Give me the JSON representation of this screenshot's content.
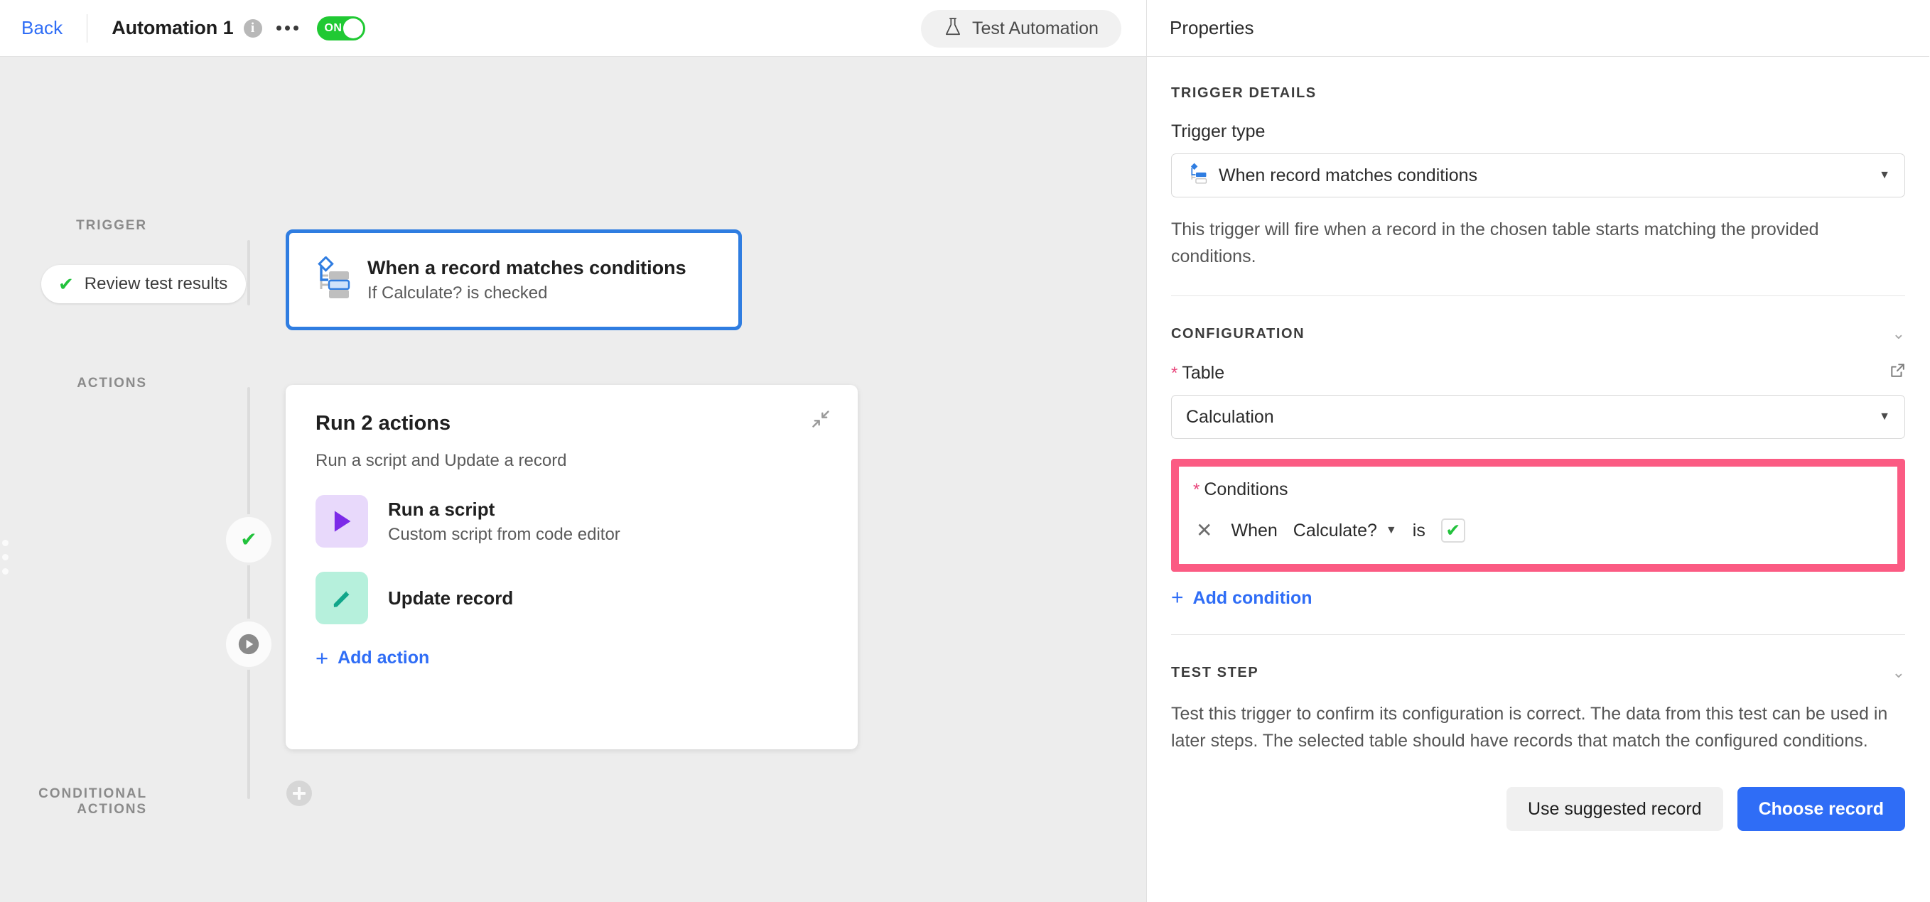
{
  "topbar": {
    "back_label": "Back",
    "automation_title": "Automation 1",
    "info_icon": "info-icon",
    "more_icon": "ellipsis-icon",
    "toggle_state_label": "ON",
    "toggle_on_color": "#20c933",
    "test_automation_label": "Test Automation",
    "test_automation_icon": "flask-icon"
  },
  "canvas": {
    "rail_labels": {
      "trigger": "TRIGGER",
      "actions": "ACTIONS",
      "conditional_actions": "CONDITIONAL ACTIONS"
    },
    "review_pill": {
      "label": "Review test results",
      "icon": "check-icon",
      "icon_color": "#22c23c"
    },
    "trigger_card": {
      "title": "When a record matches conditions",
      "subtitle": "If Calculate? is checked",
      "icon": "branch-conditions-icon",
      "border_color": "#2f7de1"
    },
    "actions_card": {
      "title": "Run 2 actions",
      "subtitle": "Run a script and Update a record",
      "collapse_icon": "collapse-diagonal-icon",
      "add_action_label": "Add action",
      "items": [
        {
          "title": "Run a script",
          "subtitle": "Custom script from code editor",
          "icon": "play-triangle-icon",
          "icon_bg": "#e8d9fb",
          "icon_color": "#7c2ae8"
        },
        {
          "title": "Update record",
          "subtitle": "",
          "icon": "pencil-icon",
          "icon_bg": "#b6f0dc",
          "icon_color": "#11a68a"
        }
      ]
    },
    "timeline": {
      "node_done_icon": "check-icon",
      "node_pending_icon": "play-circle-icon"
    },
    "conditional_add_icon": "plus-circle-icon"
  },
  "properties": {
    "header": "Properties",
    "trigger_details": {
      "section_title": "TRIGGER DETAILS",
      "trigger_type_label": "Trigger type",
      "trigger_type_value": "When record matches conditions",
      "trigger_type_icon": "branch-conditions-icon",
      "description": "This trigger will fire when a record in the chosen table starts matching the provided conditions."
    },
    "configuration": {
      "section_title": "CONFIGURATION",
      "collapse_icon": "chevron-down-icon",
      "table_label": "Table",
      "table_required_marker": "*",
      "table_value": "Calculation",
      "table_external_icon": "external-link-icon",
      "conditions_label": "Conditions",
      "conditions_required_marker": "*",
      "highlight_color": "#fb5b83",
      "condition_row": {
        "remove_icon": "close-x-icon",
        "when_label": "When",
        "field_name": "Calculate?",
        "field_caret_icon": "caret-down-icon",
        "operator_label": "is",
        "value_checked": true,
        "value_icon": "check-icon"
      },
      "add_condition_label": "Add condition"
    },
    "test_step": {
      "section_title": "TEST STEP",
      "collapse_icon": "chevron-down-icon",
      "description": "Test this trigger to confirm its configuration is correct. The data from this test can be used in later steps. The selected table should have records that match the configured conditions.",
      "use_suggested_label": "Use suggested record",
      "choose_record_label": "Choose record",
      "primary_color": "#2f6df6"
    }
  }
}
